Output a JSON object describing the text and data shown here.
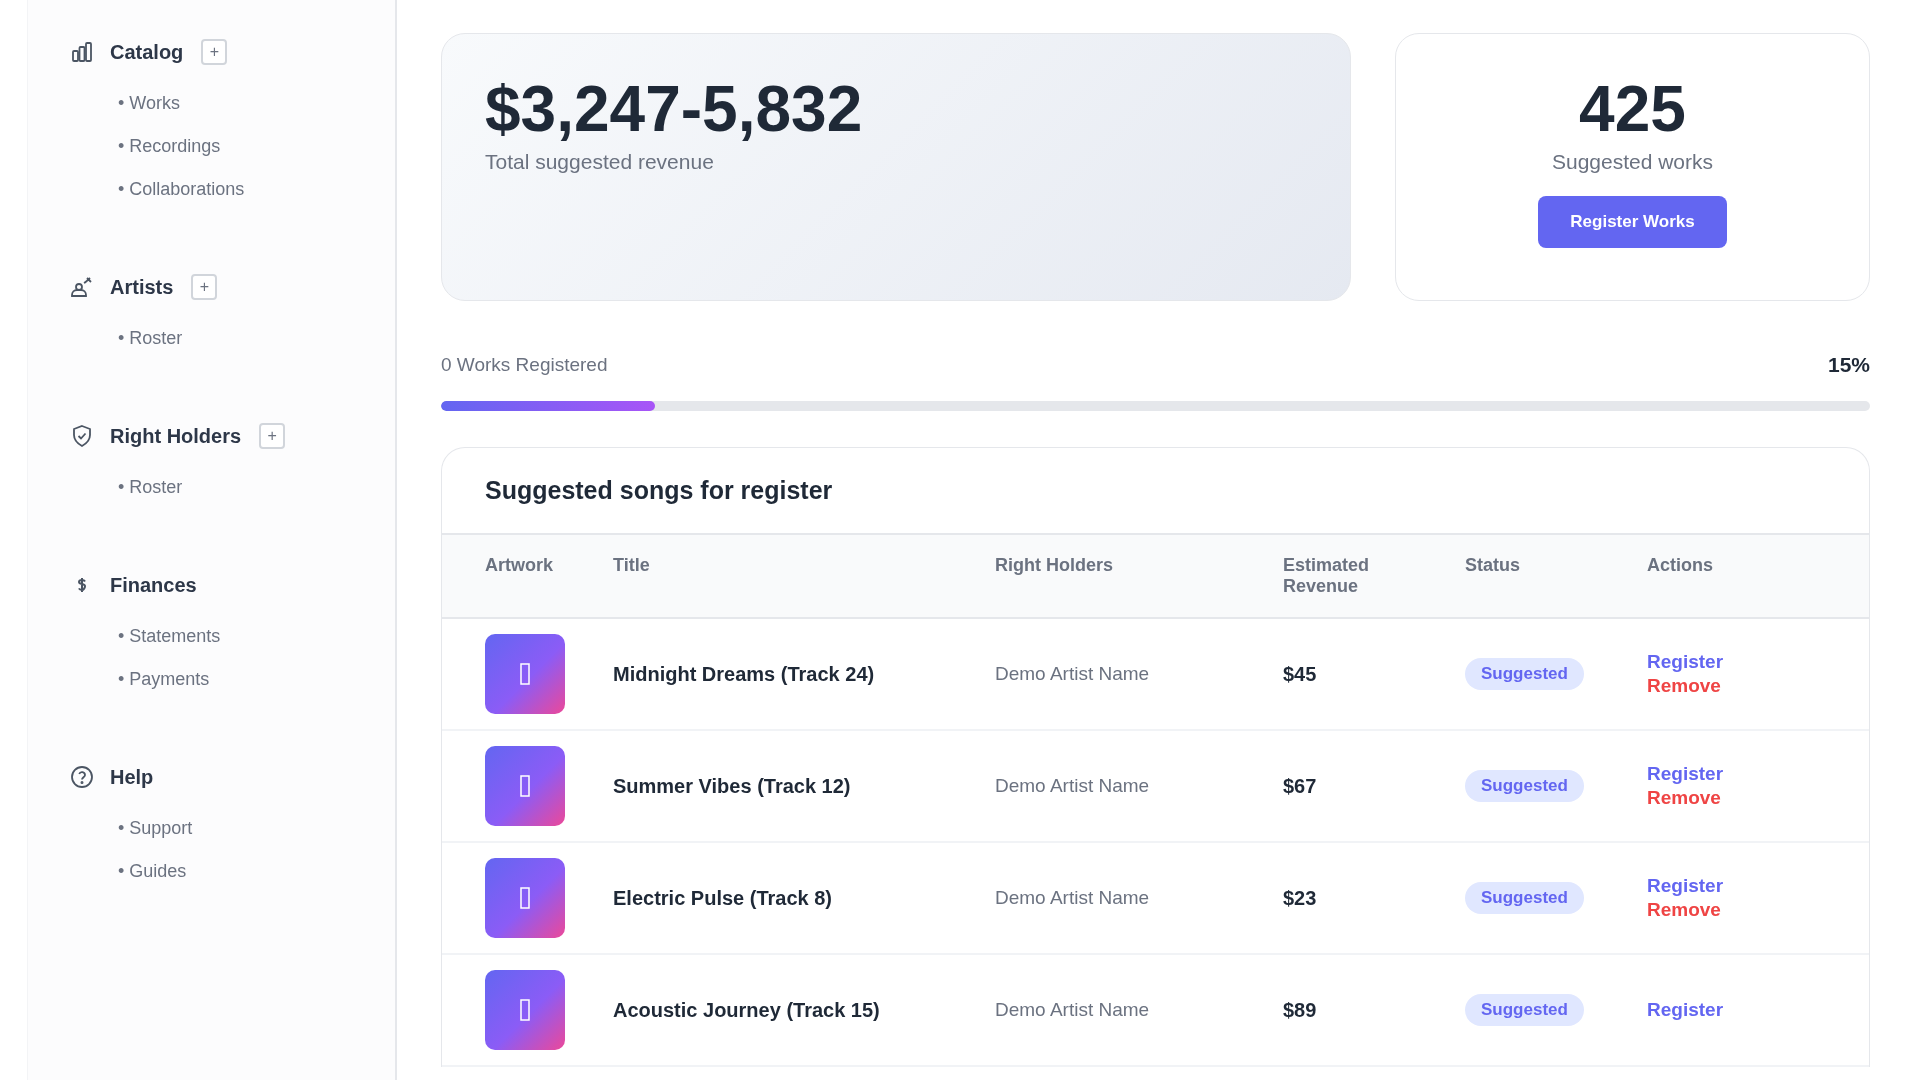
{
  "sidebar": {
    "sections": [
      {
        "title": "Catalog",
        "kind": "chart",
        "add_button": "+",
        "items": [
          "• Works",
          "• Recordings",
          "• Collaborations"
        ]
      },
      {
        "title": "Artists",
        "kind": "people",
        "add_button": "+",
        "items": [
          "• Roster"
        ]
      },
      {
        "title": "Right Holders",
        "kind": "shield",
        "add_button": "+",
        "items": [
          "• Roster"
        ]
      },
      {
        "title": "Finances",
        "kind": "dollar",
        "items": [
          "• Statements",
          "• Payments"
        ]
      },
      {
        "title": "Help",
        "kind": "help",
        "items": [
          "• Support",
          "• Guides"
        ]
      }
    ]
  },
  "revenue_card": {
    "value": "$3,247-5,832",
    "label": "Total suggested revenue"
  },
  "works_card": {
    "value": "425",
    "label": "Suggested works",
    "button": "Register Works"
  },
  "progress": {
    "label": "0 Works Registered",
    "percent": "15%",
    "level": 0.15
  },
  "table": {
    "title": "Suggested songs for register",
    "columns": [
      "Artwork",
      "Title",
      "Right Holders",
      "Estimated Revenue",
      "Status",
      "Actions"
    ],
    "rows": [
      {
        "title": "Midnight Dreams (Track 24)",
        "right_holders": "Demo Artist Name",
        "revenue": "$45",
        "status": "Suggested",
        "actions": [
          {
            "kind": "register",
            "label": "Register"
          },
          {
            "kind": "remove",
            "label": "Remove"
          }
        ]
      },
      {
        "title": "Summer Vibes (Track 12)",
        "right_holders": "Demo Artist Name",
        "revenue": "$67",
        "status": "Suggested",
        "actions": [
          {
            "kind": "register",
            "label": "Register"
          },
          {
            "kind": "remove",
            "label": "Remove"
          }
        ]
      },
      {
        "title": "Electric Pulse (Track 8)",
        "right_holders": "Demo Artist Name",
        "revenue": "$23",
        "status": "Suggested",
        "actions": [
          {
            "kind": "register",
            "label": "Register"
          },
          {
            "kind": "remove",
            "label": "Remove"
          }
        ]
      },
      {
        "title": "Acoustic Journey (Track 15)",
        "right_holders": "Demo Artist Name",
        "revenue": "$89",
        "status": "Suggested",
        "actions": [
          {
            "kind": "register",
            "label": "Register"
          }
        ]
      }
    ]
  }
}
